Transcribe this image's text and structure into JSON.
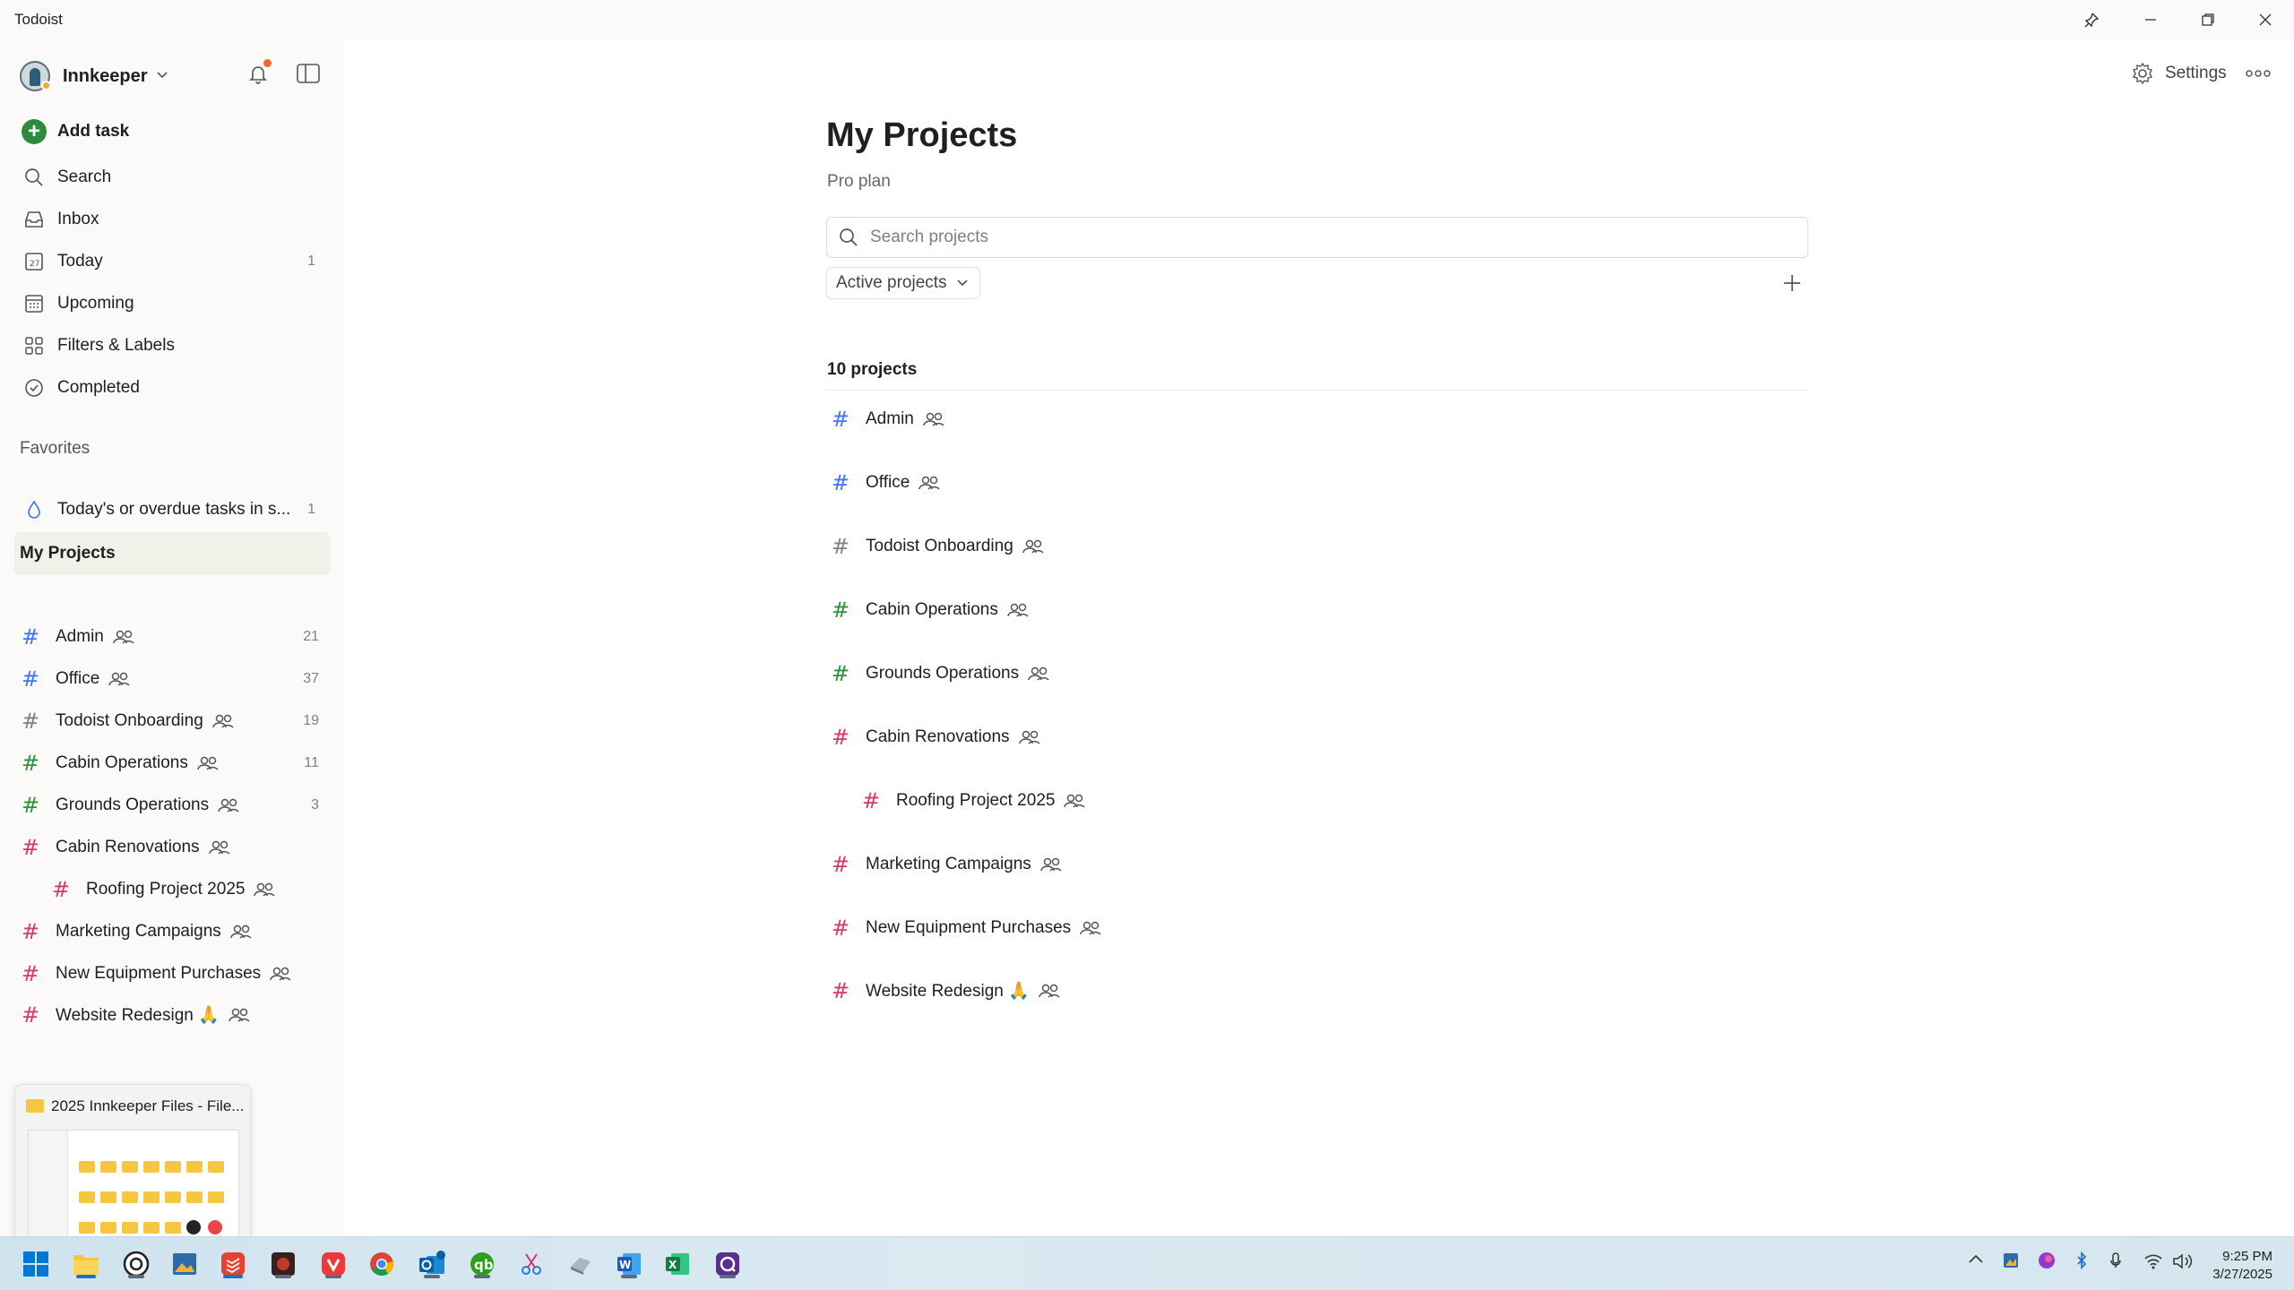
{
  "window": {
    "title": "Todoist"
  },
  "sidebar": {
    "user": "Innkeeper",
    "nav": [
      {
        "label": "Add task",
        "count": ""
      },
      {
        "label": "Search",
        "count": ""
      },
      {
        "label": "Inbox",
        "count": ""
      },
      {
        "label": "Today",
        "count": "1"
      },
      {
        "label": "Upcoming",
        "count": ""
      },
      {
        "label": "Filters & Labels",
        "count": ""
      },
      {
        "label": "Completed",
        "count": ""
      }
    ],
    "favorites_heading": "Favorites",
    "favorites": [
      {
        "label": "Today's or overdue tasks in s...",
        "count": "1"
      }
    ],
    "projects_heading": "My Projects",
    "projects": [
      {
        "label": "Admin",
        "count": "21",
        "color": "#4073ff"
      },
      {
        "label": "Office",
        "count": "37",
        "color": "#4073ff"
      },
      {
        "label": "Todoist Onboarding",
        "count": "19",
        "color": "#808080"
      },
      {
        "label": "Cabin Operations",
        "count": "11",
        "color": "#299438"
      },
      {
        "label": "Grounds Operations",
        "count": "3",
        "color": "#299438"
      },
      {
        "label": "Cabin Renovations",
        "count": "",
        "color": "#d9386b"
      },
      {
        "label": "Roofing Project 2025",
        "count": "",
        "color": "#d9386b"
      },
      {
        "label": "Marketing Campaigns",
        "count": "",
        "color": "#d9386b"
      },
      {
        "label": "New Equipment Purchases",
        "count": "",
        "color": "#d9386b"
      },
      {
        "label": "Website Redesign 🙏",
        "count": "",
        "color": "#d9386b"
      }
    ]
  },
  "preview": {
    "title": "2025 Innkeeper Files - File..."
  },
  "main": {
    "settings_label": "Settings",
    "title": "My Projects",
    "subtitle": "Pro plan",
    "search_placeholder": "Search projects",
    "filter": "Active projects",
    "count_label": "10 projects"
  },
  "taskbar": {
    "time": "9:25 PM",
    "date": "3/27/2025"
  }
}
